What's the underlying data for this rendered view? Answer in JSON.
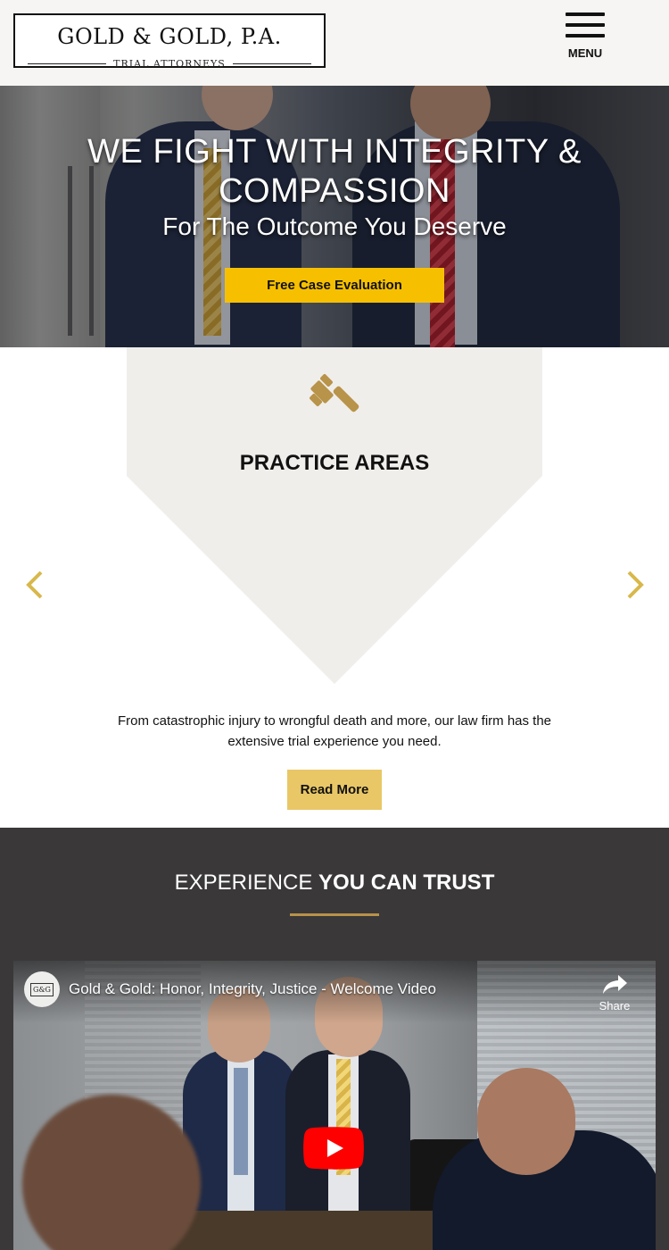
{
  "header": {
    "logo_main": "GOLD & GOLD, P.A.",
    "logo_sub": "TRIAL ATTORNEYS",
    "menu_label": "MENU"
  },
  "hero": {
    "title": "WE FIGHT WITH INTEGRITY & COMPASSION",
    "subtitle": "For The Outcome You Deserve",
    "cta_label": "Free Case Evaluation"
  },
  "practice": {
    "title": "PRACTICE AREAS",
    "description": "From catastrophic injury to wrongful death and more, our law firm has the extensive trial experience you need.",
    "read_more_label": "Read More"
  },
  "experience": {
    "title_light": "EXPERIENCE",
    "title_bold": "YOU CAN TRUST"
  },
  "video": {
    "title": "Gold & Gold: Honor, Integrity, Justice - Welcome Video",
    "channel_icon_text": "G&G",
    "share_label": "Share"
  },
  "colors": {
    "cta_yellow": "#f6c000",
    "read_more_gold": "#e9c766",
    "accent_gold": "#b8934a",
    "arrow_gold": "#d8b84a",
    "dark_section": "#3a3839",
    "practice_bg": "#f0eeeb",
    "youtube_red": "#ff0000"
  },
  "icons": [
    "menu-icon",
    "gavel-icon",
    "chevron-left-icon",
    "chevron-right-icon",
    "share-icon",
    "play-icon"
  ]
}
